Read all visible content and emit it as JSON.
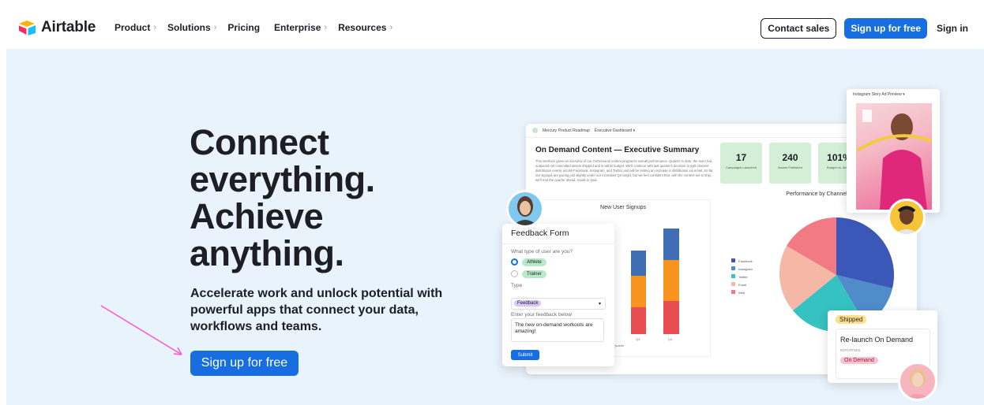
{
  "nav": {
    "brand": "Airtable",
    "menu": [
      {
        "label": "Product",
        "chevron": "›"
      },
      {
        "label": "Solutions",
        "chevron": "›"
      },
      {
        "label": "Pricing",
        "chevron": ""
      },
      {
        "label": "Enterprise",
        "chevron": "›"
      },
      {
        "label": "Resources",
        "chevron": "›"
      }
    ],
    "contact_sales": "Contact sales",
    "signup": "Sign up for free",
    "signin": "Sign in"
  },
  "hero": {
    "headline": "Connect everything. Achieve anything.",
    "subtitle": "Accelerate work and unlock potential with powerful apps that connect your data, workflows and teams.",
    "cta": "Sign up for free"
  },
  "dashboard": {
    "breadcrumb_a": "Mercury Product Roadmap",
    "breadcrumb_b": "Executive Dashboard ▾",
    "title": "On Demand Content — Executive Summary",
    "description": "This interface gives an overview of our OnDemand content program's overall performance. Quarter to date, the team has outpaced net committed assets shipped and is within budget. We'll continue with last quarter's decision to split channel distribution evenly across Facebook, Instagram, and Twitter and will be testing an increase in distribution via email. So far, our signups are pacing just slightly under our increased Q4 target, but we feel confident that, with the content set to ship, we'll end the quarter ahead. Goals to goal.",
    "stats": [
      {
        "value": "17",
        "label": "Campaigns Launched"
      },
      {
        "value": "240",
        "label": "Assets Published"
      },
      {
        "value": "101%",
        "label": "Budget vs. Actual"
      }
    ],
    "signups_title": "New User Signups",
    "signups_axis": [
      "Quarter",
      "Q3",
      "Q4"
    ],
    "channel_title": "Performance by Channel",
    "legend": [
      "Facebook",
      "Instagram",
      "Twitter",
      "Email",
      "Web"
    ]
  },
  "form": {
    "title": "Feedback Form",
    "q1": "What type of user are you?",
    "opt1": "Athlete",
    "opt2": "Trainer",
    "type_label": "Type",
    "type_value": "Feedback",
    "feedback_label": "Enter your feedback below",
    "feedback_value": "The new on-demand workouts are amazing!",
    "submit": "Submit"
  },
  "insta": {
    "title": "Instagram Story Ad Preview ▾"
  },
  "ship": {
    "tag": "Shipped",
    "title": "Re-launch On Demand",
    "sub": "INITIATIVES",
    "chip": "On Demand"
  },
  "colors": {
    "accent": "#166ee1",
    "hero_bg": "#e9f3fb",
    "arrow": "#ff4fd8"
  }
}
